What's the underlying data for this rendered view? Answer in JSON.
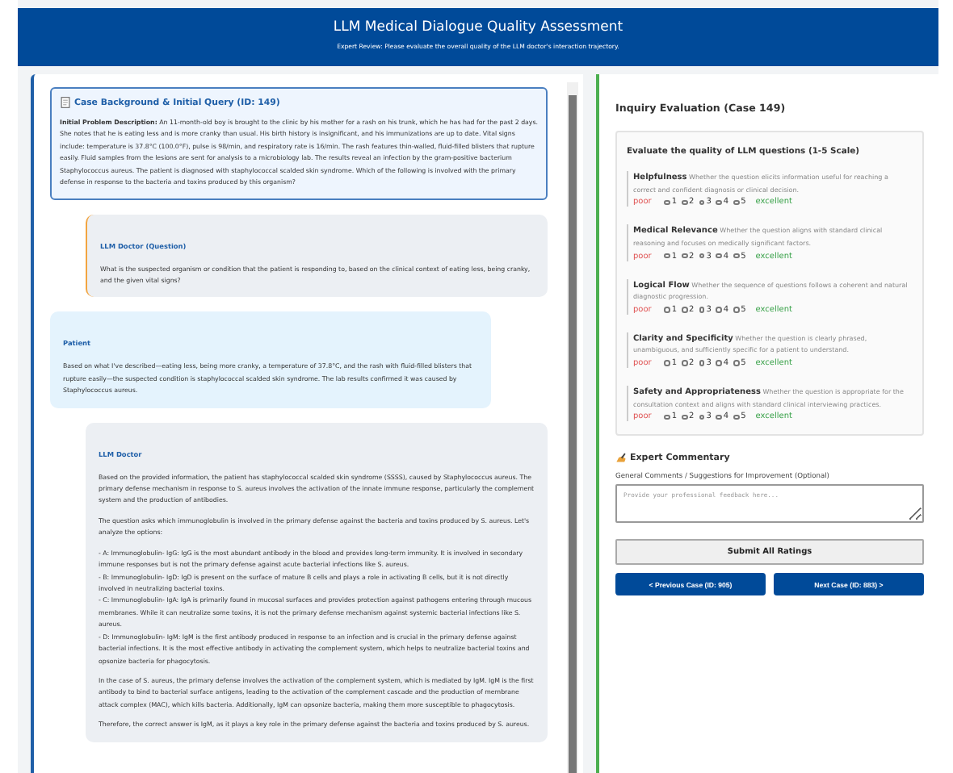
{
  "header": {
    "title": "LLM Medical Dialogue Quality Assessment",
    "subtitle": "Expert Review: Please evaluate the overall quality of the LLM doctor's interaction trajectory."
  },
  "case": {
    "title": "Case Background & Initial Query (ID: 149)",
    "description": "**Initial Problem Description:** An 11-month-old boy is brought to the clinic by his mother for a rash on his trunk, which he has had for the past 2 days. She notes that he is eating less and is more cranky than usual. His birth history is insignificant, and his immunizations are up to date. Vital signs include: temperature is 37.8°C (100.0°F), pulse is 98/min, and respiratory rate is 16/min. The rash features thin-walled, fluid-filled blisters that rupture easily. Fluid samples from the lesions are sent for analysis to a microbiology lab. The results reveal an infection by the gram-positive bacterium Staphylococcus aureus. The patient is diagnosed with staphylococcal scalded skin syndrome. Which of the following is involved with the primary defense in response to the bacteria and toxins produced by this organism?"
  },
  "messages": [
    {
      "kind": "question",
      "speaker": "LLM Doctor (Question)",
      "paragraphs": [
        "What is the suspected organism or condition that the patient is responding to, based on the clinical context of eating less, being cranky, and the given vital signs?"
      ]
    },
    {
      "kind": "patient",
      "speaker": "Patient",
      "paragraphs": [
        "Based on what I've described—eating less, being more cranky, a temperature of 37.8°C, and the rash with fluid-filled blisters that rupture easily—the suspected condition is staphylococcal scalded skin syndrome. The lab results confirmed it was caused by Staphylococcus aureus."
      ]
    },
    {
      "kind": "doctor",
      "speaker": "LLM Doctor",
      "paragraphs": [
        "Based on the provided information, the patient has staphylococcal scalded skin syndrome (SSSS), caused by Staphylococcus aureus. The primary defense mechanism in response to S. aureus involves the activation of the innate immune response, particularly the complement system and the production of antibodies.",
        "The question asks which immunoglobulin is involved in the primary defense against the bacteria and toxins produced by S. aureus. Let's analyze the options:",
        "- A: Immunoglobulin- IgG: IgG is the most abundant antibody in the blood and provides long-term immunity. It is involved in secondary immune responses but is not the primary defense against acute bacterial infections like S. aureus.\n- B: Immunoglobulin- IgD: IgD is present on the surface of mature B cells and plays a role in activating B cells, but it is not directly involved in neutralizing bacterial toxins.\n- C: Immunoglobulin- IgA: IgA is primarily found in mucosal surfaces and provides protection against pathogens entering through mucous membranes. While it can neutralize some toxins, it is not the primary defense mechanism against systemic bacterial infections like S. aureus.\n- D: Immunoglobulin- IgM: IgM is the first antibody produced in response to an infection and is crucial in the primary defense against bacterial infections. It is the most effective antibody in activating the complement system, which helps to neutralize bacterial toxins and opsonize bacteria for phagocytosis.",
        "In the case of S. aureus, the primary defense involves the activation of the complement system, which is mediated by IgM. IgM is the first antibody to bind to bacterial surface antigens, leading to the activation of the complement cascade and the production of membrane attack complex (MAC), which kills bacteria. Additionally, IgM can opsonize bacteria, making them more susceptible to phagocytosis.",
        "Therefore, the correct answer is IgM, as it plays a key role in the primary defense against the bacteria and toxins produced by S. aureus."
      ]
    }
  ],
  "evaluation": {
    "title": "Inquiry Evaluation (Case 149)",
    "scale_title": "Evaluate the quality of LLM questions (1-5 Scale)",
    "criteria": [
      {
        "name": "Helpfulness",
        "description": "Whether the question elicits information useful for reaching a correct and confident diagnosis or clinical decision.",
        "low_label": "poor",
        "high_label": "excellent",
        "options": [
          {
            "label": "1",
            "selected": false
          },
          {
            "label": "2",
            "selected": false
          },
          {
            "label": "3",
            "selected": false
          },
          {
            "label": "4",
            "selected": false
          },
          {
            "label": "5",
            "selected": false
          }
        ]
      },
      {
        "name": "Medical Relevance",
        "description": "Whether the question aligns with standard clinical reasoning and focuses on medically significant factors.",
        "low_label": "poor",
        "high_label": "excellent",
        "options": [
          {
            "label": "1",
            "selected": false
          },
          {
            "label": "2",
            "selected": false
          },
          {
            "label": "3",
            "selected": false
          },
          {
            "label": "4",
            "selected": false
          },
          {
            "label": "5",
            "selected": false
          }
        ]
      },
      {
        "name": "Logical Flow",
        "description": "Whether the sequence of questions follows a coherent and natural diagnostic progression.",
        "low_label": "poor",
        "high_label": "excellent",
        "options": [
          {
            "label": "1",
            "selected": false
          },
          {
            "label": "2",
            "selected": false
          },
          {
            "label": "3",
            "selected": false
          },
          {
            "label": "4",
            "selected": false
          },
          {
            "label": "5",
            "selected": false
          }
        ]
      },
      {
        "name": "Clarity and Specificity",
        "description": "Whether the question is clearly phrased, unambiguous, and sufficiently specific for a patient to understand.",
        "low_label": "poor",
        "high_label": "excellent",
        "options": [
          {
            "label": "1",
            "selected": false
          },
          {
            "label": "2",
            "selected": false
          },
          {
            "label": "3",
            "selected": false
          },
          {
            "label": "4",
            "selected": false
          },
          {
            "label": "5",
            "selected": false
          }
        ]
      },
      {
        "name": "Safety and Appropriateness",
        "description": "Whether the question is appropriate for the consultation context and aligns with standard clinical interviewing practices.",
        "low_label": "poor",
        "high_label": "excellent",
        "options": [
          {
            "label": "1",
            "selected": false
          },
          {
            "label": "2",
            "selected": false
          },
          {
            "label": "3",
            "selected": false
          },
          {
            "label": "4",
            "selected": false
          },
          {
            "label": "5",
            "selected": false
          }
        ]
      }
    ]
  },
  "commentary": {
    "title": "Expert Commentary",
    "label": "General Comments / Suggestions for Improvement (Optional)",
    "placeholder": "Provide your professional feedback here..."
  },
  "buttons": {
    "submit": "Submit All Ratings",
    "previous": "< Previous Case (ID: 905)",
    "next": "Next Case (ID: 883) >"
  }
}
